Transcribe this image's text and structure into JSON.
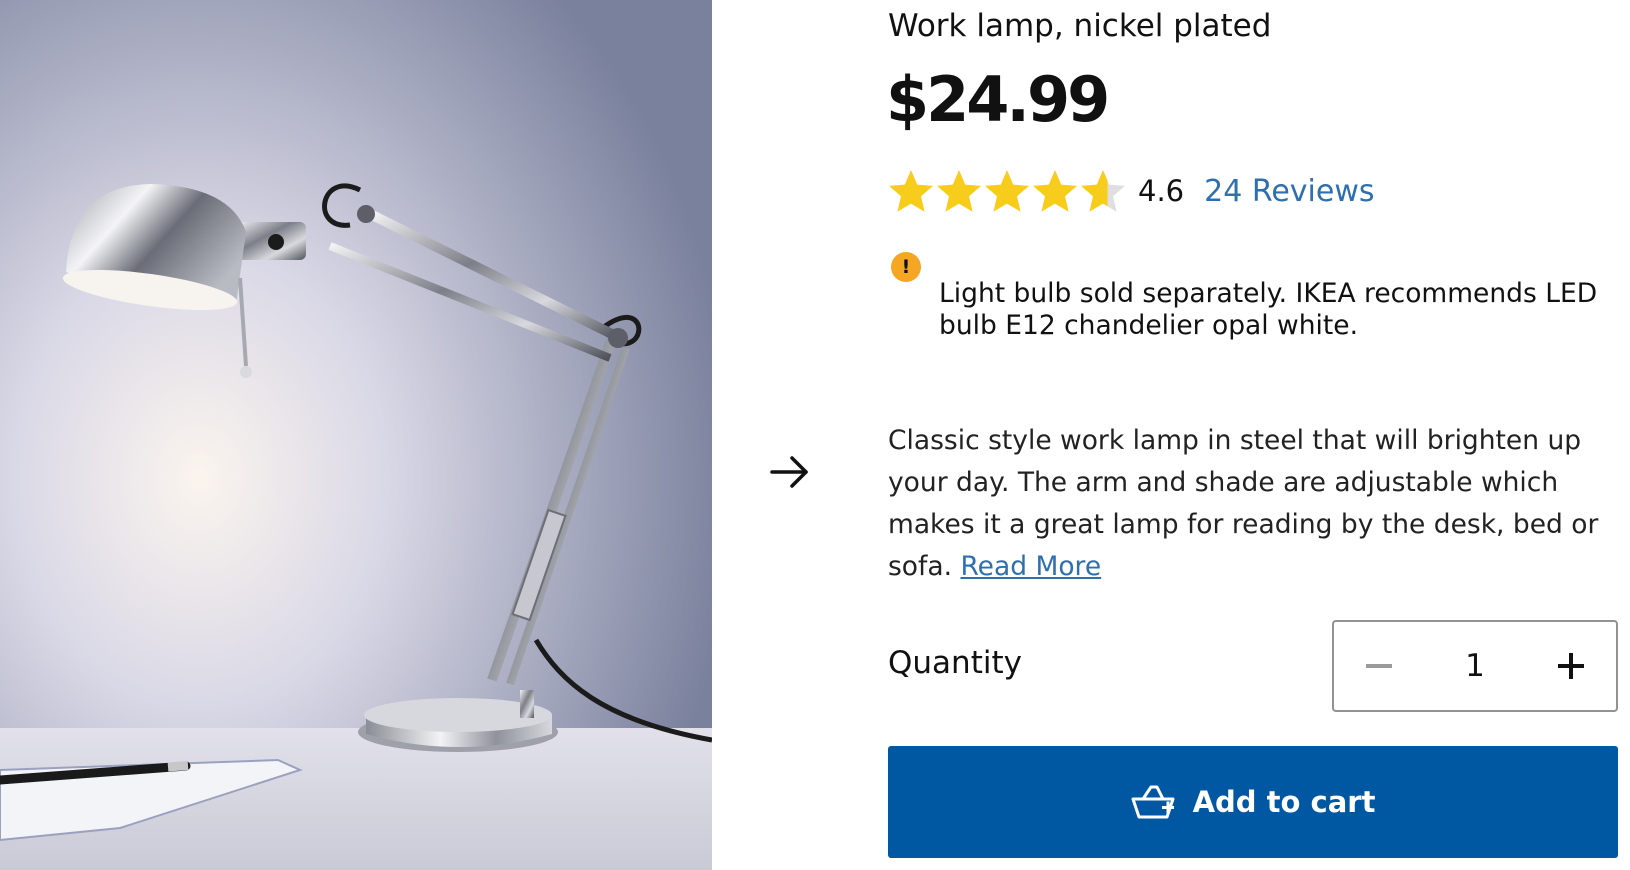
{
  "product": {
    "name": "Work lamp, nickel plated",
    "price": "$24.99",
    "rating_value": "4.6",
    "rating_fraction": 0.92,
    "reviews_link": "24 Reviews",
    "notice_icon": "!",
    "notice_text": "Light bulb sold separately. IKEA recommends LED bulb E12 chandelier opal white.",
    "description": "Classic style work lamp in steel that will brighten up your day. The arm and shade are adjustable which makes it a great lamp for reading by the desk, bed or sofa.",
    "read_more": "Read More"
  },
  "quantity": {
    "label": "Quantity",
    "value": "1"
  },
  "cart": {
    "button_label": "Add to cart"
  },
  "icons": {
    "star_filled": "star-icon",
    "next": "arrow-right-icon",
    "minus": "minus-icon",
    "plus": "plus-icon",
    "cart": "shopping-basket-icon",
    "notice": "exclamation-icon"
  },
  "colors": {
    "star": "#f8cc1b",
    "star_empty": "#dfdfdf",
    "link": "#2e6faf",
    "button": "#0058a3",
    "notice": "#f5a623"
  }
}
